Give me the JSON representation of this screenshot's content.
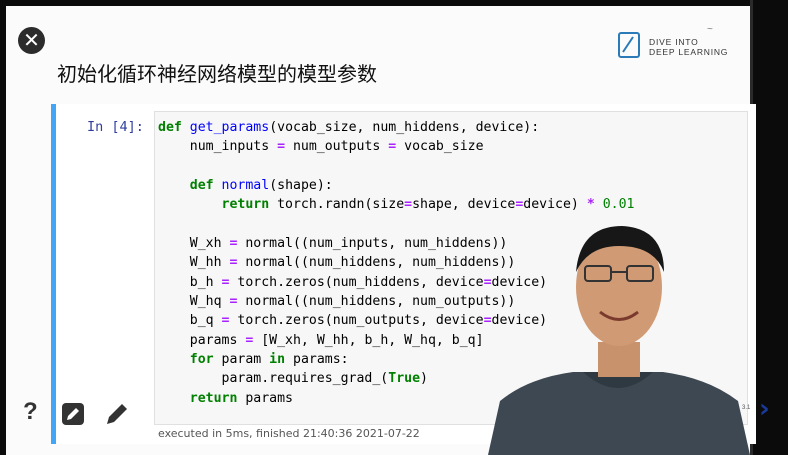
{
  "slide": {
    "title": "初始化循环神经网络模型的模型参数",
    "logo_text": "DIVE INTO\nDEEP LEARNING",
    "corner_mark": "~"
  },
  "cell": {
    "prompt": "In [4]:",
    "execution_info": "executed in 5ms, finished 21:40:36 2021-07-22"
  },
  "code_lines": [
    "def get_params(vocab_size, num_hiddens, device):",
    "    num_inputs = num_outputs = vocab_size",
    "",
    "    def normal(shape):",
    "        return torch.randn(size=shape, device=device) * 0.01",
    "",
    "    W_xh = normal((num_inputs, num_hiddens))",
    "    W_hh = normal((num_hiddens, num_hiddens))",
    "    b_h = torch.zeros(num_hiddens, device=device)",
    "    W_hq = normal((num_hiddens, num_outputs))",
    "    b_q = torch.zeros(num_outputs, device=device)",
    "    params = [W_xh, W_hh, b_h, W_hq, b_q]",
    "    for param in params:",
    "        param.requires_grad_(True)",
    "    return params"
  ],
  "controls": {
    "close_icon": "close-icon",
    "help_label": "?",
    "edit_icon": "edit-icon",
    "pencil_icon": "pencil-icon",
    "prev_arrow": "‹",
    "next_arrow": "›",
    "slide_number": "3.1"
  },
  "colors": {
    "cell_border": "#42a5f5",
    "keyword": "#008000",
    "function": "#0000ff",
    "prompt": "#303f9f"
  }
}
